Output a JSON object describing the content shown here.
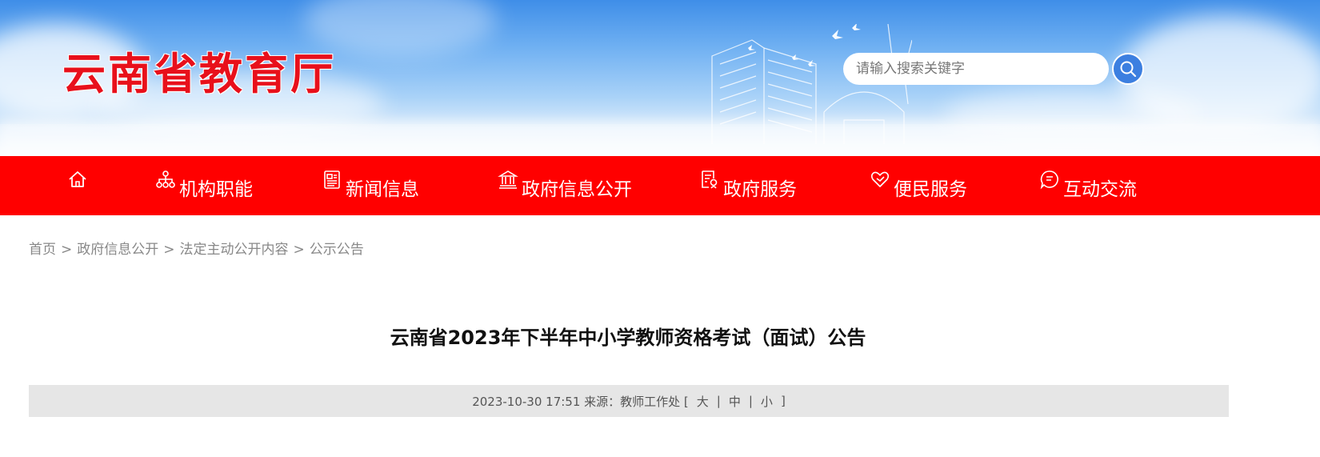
{
  "header": {
    "site_title": "云南省教育厅",
    "search_placeholder": "请输入搜索关键字"
  },
  "nav": {
    "items": [
      {
        "label": "",
        "icon": "home-icon"
      },
      {
        "label": "机构职能",
        "icon": "org-chart-icon"
      },
      {
        "label": "新闻信息",
        "icon": "newspaper-icon"
      },
      {
        "label": "政府信息公开",
        "icon": "government-building-icon"
      },
      {
        "label": "政府服务",
        "icon": "service-document-icon"
      },
      {
        "label": "便民服务",
        "icon": "heart-hand-icon"
      },
      {
        "label": "互动交流",
        "icon": "chat-icon"
      }
    ]
  },
  "breadcrumb": {
    "items": [
      "首页",
      "政府信息公开",
      "法定主动公开内容",
      "公示公告"
    ],
    "separator": ">"
  },
  "article": {
    "title": "云南省2023年下半年中小学教师资格考试（面试）公告",
    "meta_text": "2023-10-30 17:51 来源：教师工作处 [",
    "font_large": "大",
    "font_medium": "中",
    "font_small": "小",
    "bracket_close": "]",
    "pipe": "|"
  },
  "colors": {
    "nav_bg": "#ff0000",
    "title_red": "#e8101b",
    "search_button": "#3c7fe0",
    "meta_bg": "#e6e6e6"
  }
}
